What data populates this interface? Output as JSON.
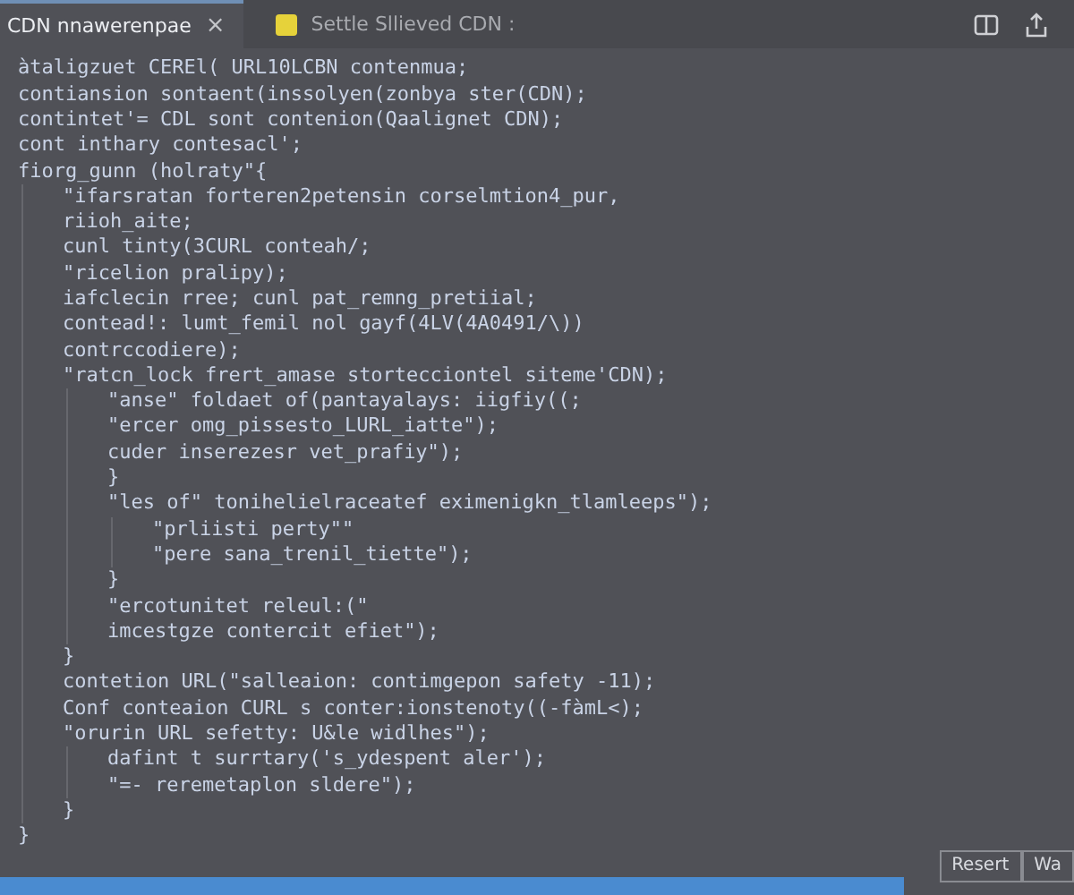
{
  "tabs": [
    {
      "label": "CDN nnawerenpae",
      "selected": true,
      "close": "×"
    },
    {
      "label": "Settle  Sllieved CDN :",
      "selected": false
    }
  ],
  "code": [
    {
      "text": "àtaligzuet CEREl( URL10LCBN contenmua;"
    },
    {
      "text": "contiansion sontaent(inssolyen(zonbya ster(CDN);"
    },
    {
      "text": "contintet'= CDL sont contenion(Qaalignet CDN);"
    },
    {
      "text": "cont inthary contesacl';"
    },
    {
      "text": "fiorg_gunn (holraty\"{",
      "children": [
        {
          "text": "\"ifarsratan forteren2petensin corselmtion4_pur,"
        },
        {
          "text": "riioh_aite;"
        },
        {
          "text": "cunl tinty(3CURL conteah/;"
        },
        {
          "text": "\"ricelion pralipy);"
        },
        {
          "text": "iafclecin rree; cunl pat_remng_pretiial;"
        },
        {
          "text": "contead!: lumt_femil nol gayf(4LV(4A0491/\\))"
        },
        {
          "text": "contrccodiere);"
        },
        {
          "text": "\"ratcn_lock frert_amase stortecciontel siteme'CDN);",
          "children": [
            {
              "text": "\"anse\" foldaet of(pantayalays: iigfiy((;"
            },
            {
              "text": "\"ercer omg_pissesto_LURL_iatte\");"
            },
            {
              "text": "cuder inserezesr vet_prafiy\");"
            },
            {
              "text": "}"
            },
            {
              "text": "\"les of\" tonihelielraceatef eximenigkn_tlamleeps\");",
              "children": [
                {
                  "text": "\"prliisti perty\"\""
                },
                {
                  "text": "\"pere sana_trenil_tiette\");"
                }
              ]
            },
            {
              "text": "}"
            },
            {
              "text": "\"ercotunitet releul:(\""
            },
            {
              "text": "imcestgze contercit efiet\");"
            }
          ]
        },
        {
          "text": "}"
        },
        {
          "text": "contetion URL(\"salleaion: contimgepon safety -11);"
        },
        {
          "text": "Conf conteaion CURL s conter:ionstenoty((-fàmL<);"
        },
        {
          "text": "\"orurin URL sefetty: U&le widlhes\");",
          "children": [
            {
              "text": "dafint t surrtary('s_ydespent aler');"
            },
            {
              "text": "\"=- reremetaplon sldere\");"
            }
          ]
        },
        {
          "text": "}"
        }
      ]
    },
    {
      "text": "}"
    }
  ],
  "buttons": [
    "Resert",
    "Wa"
  ]
}
